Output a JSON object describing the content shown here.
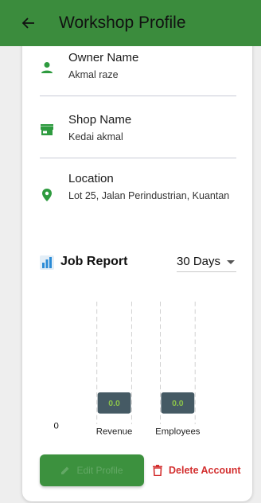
{
  "appbar": {
    "title": "Workshop Profile",
    "back_icon": "arrow-back-icon"
  },
  "profile": {
    "owner": {
      "label": "Owner Name",
      "value": "Akmal raze",
      "icon": "person-icon"
    },
    "shop": {
      "label": "Shop Name",
      "value": "Kedai akmal",
      "icon": "store-icon"
    },
    "location": {
      "label": "Location",
      "value": "Lot 25, Jalan Perindustrian, Kuantan",
      "icon": "location-pin-icon"
    }
  },
  "report": {
    "title": "Job Report",
    "icon": "bar-chart-icon",
    "range": "30 Days"
  },
  "chart_data": {
    "type": "bar",
    "categories": [
      "Revenue",
      "Employees"
    ],
    "values": [
      0.0,
      0.0
    ],
    "data_labels": [
      "0.0",
      "0.0"
    ],
    "y_tick_labels": [
      "0"
    ],
    "grid": true,
    "bar_color": "#455a64",
    "label_color": "#8bc34a"
  },
  "actions": {
    "edit_label": "Edit Profile",
    "delete_label": "Delete Account"
  },
  "colors": {
    "primary": "#3b8c3d",
    "danger": "#d32f2f",
    "location_icon": "#2e9b3f"
  }
}
